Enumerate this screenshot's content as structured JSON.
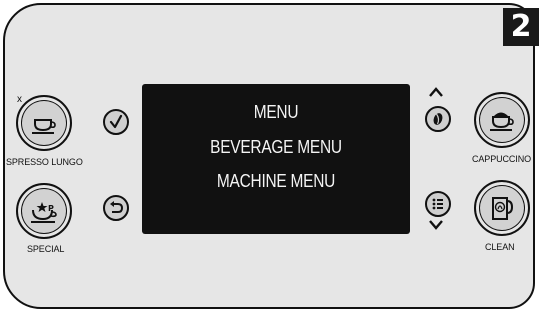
{
  "step_number": "2",
  "display": {
    "line1": "MENU",
    "line2": "BEVERAGE MENU",
    "line3": "MACHINE MENU"
  },
  "buttons": {
    "espresso_lungo": {
      "label": "SPRESSO LUNGO",
      "icon": "cup-icon",
      "marker": "x"
    },
    "special": {
      "label": "SPECIAL",
      "icon": "star-cup-icon"
    },
    "cappuccino": {
      "label": "CAPPUCCINO",
      "icon": "cappuccino-cup-icon"
    },
    "clean": {
      "label": "CLEAN",
      "icon": "jug-icon"
    },
    "ok": {
      "icon": "checkmark-icon"
    },
    "back": {
      "icon": "back-arrow-icon"
    },
    "aroma": {
      "icon": "coffee-bean-icon"
    },
    "menu": {
      "icon": "menu-list-icon"
    },
    "scroll_up": {
      "icon": "chevron-up-icon"
    },
    "scroll_down": {
      "icon": "chevron-down-icon"
    }
  },
  "colors": {
    "panel": "#e6e6e6",
    "screen": "#111111",
    "text_on_screen": "#f4f4f4",
    "badge": "#1a1a1a"
  }
}
